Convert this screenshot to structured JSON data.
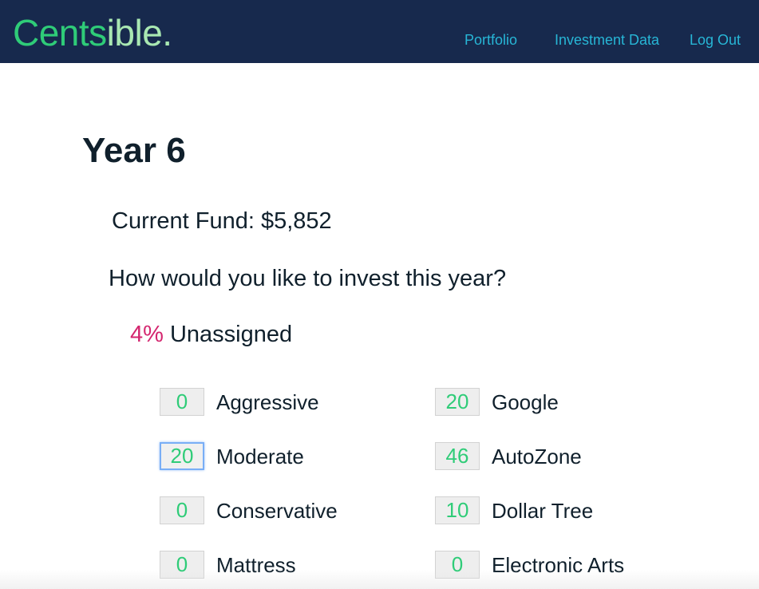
{
  "header": {
    "logo_part1": "Cents",
    "logo_part2": "ible.",
    "nav": {
      "portfolio": "Portfolio",
      "investment_data": "Investment Data",
      "logout": "Log Out"
    }
  },
  "main": {
    "year_title": "Year 6",
    "current_fund": "Current Fund: $5,852",
    "question": "How would you like to invest this year?",
    "unassigned_pct": "4%",
    "unassigned_label": " Unassigned",
    "allocations": [
      {
        "label": "Aggressive",
        "value": "0"
      },
      {
        "label": "Moderate",
        "value": "20"
      },
      {
        "label": "Conservative",
        "value": "0"
      },
      {
        "label": "Mattress",
        "value": "0"
      },
      {
        "label": "Google",
        "value": "20"
      },
      {
        "label": "AutoZone",
        "value": "46"
      },
      {
        "label": "Dollar Tree",
        "value": "10"
      },
      {
        "label": "Electronic Arts",
        "value": "0"
      }
    ]
  },
  "colors": {
    "navbar": "#17294d",
    "logo_green": "#2fcc78",
    "logo_light_green": "#a9e8b2",
    "nav_link": "#27b6d6",
    "unassigned_pct": "#d4266f",
    "input_value": "#2fcc78"
  }
}
